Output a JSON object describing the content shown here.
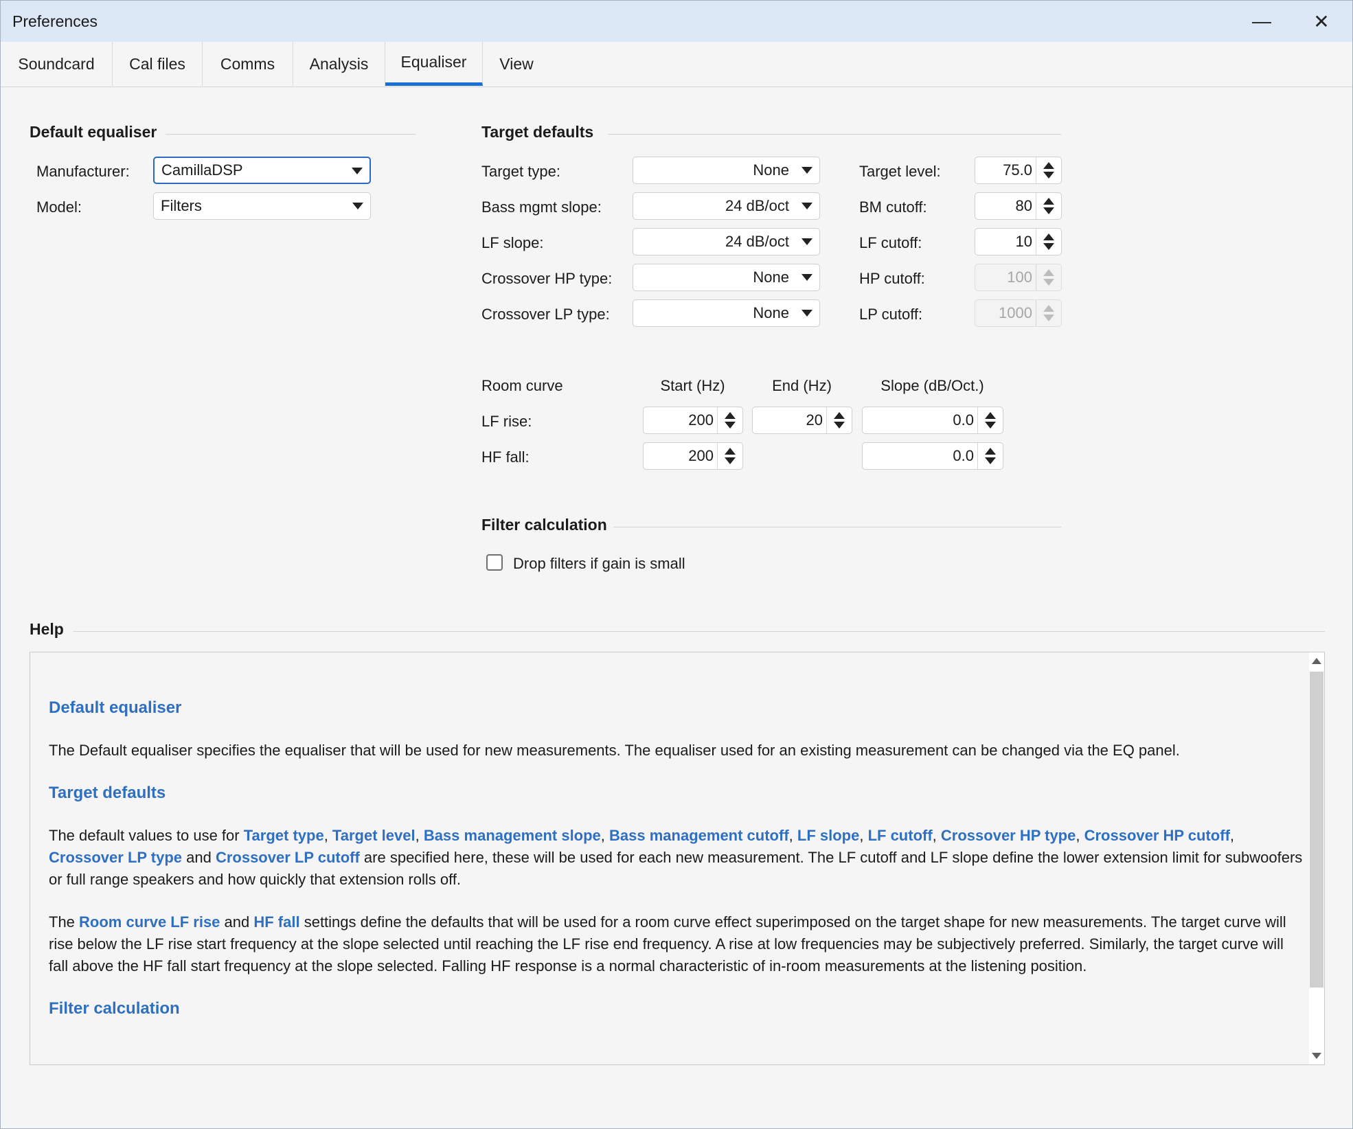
{
  "window": {
    "title": "Preferences",
    "minimize_glyph": "—",
    "close_glyph": "✕"
  },
  "tabs": [
    {
      "label": "Soundcard"
    },
    {
      "label": "Cal files"
    },
    {
      "label": "Comms"
    },
    {
      "label": "Analysis"
    },
    {
      "label": "Equaliser",
      "active": true
    },
    {
      "label": "View"
    }
  ],
  "default_equaliser": {
    "title": "Default equaliser",
    "manufacturer_label": "Manufacturer:",
    "manufacturer_value": "CamillaDSP",
    "model_label": "Model:",
    "model_value": "Filters"
  },
  "target_defaults": {
    "title": "Target defaults",
    "target_type_label": "Target type:",
    "target_type_value": "None",
    "bass_mgmt_slope_label": "Bass mgmt slope:",
    "bass_mgmt_slope_value": "24 dB/oct",
    "lf_slope_label": "LF slope:",
    "lf_slope_value": "24 dB/oct",
    "crossover_hp_type_label": "Crossover HP type:",
    "crossover_hp_type_value": "None",
    "crossover_lp_type_label": "Crossover LP type:",
    "crossover_lp_type_value": "None",
    "target_level_label": "Target level:",
    "target_level_value": "75.0",
    "bm_cutoff_label": "BM cutoff:",
    "bm_cutoff_value": "80",
    "lf_cutoff_label": "LF cutoff:",
    "lf_cutoff_value": "10",
    "hp_cutoff_label": "HP cutoff:",
    "hp_cutoff_value": "100",
    "lp_cutoff_label": "LP cutoff:",
    "lp_cutoff_value": "1000"
  },
  "room_curve": {
    "title": "Room curve",
    "start_header": "Start (Hz)",
    "end_header": "End (Hz)",
    "slope_header": "Slope (dB/Oct.)",
    "lf_rise_label": "LF rise:",
    "lf_rise_start": "200",
    "lf_rise_end": "20",
    "lf_rise_slope": "0.0",
    "hf_fall_label": "HF fall:",
    "hf_fall_start": "200",
    "hf_fall_slope": "0.0"
  },
  "filter_calculation": {
    "title": "Filter calculation",
    "drop_filters_label": "Drop filters if gain is small",
    "drop_filters_checked": false
  },
  "help": {
    "title": "Help",
    "h1": "Default equaliser",
    "p1": "The Default equaliser specifies the equaliser that will be used for new measurements. The equaliser used for an existing measurement can be changed via the EQ panel.",
    "h2": "Target defaults",
    "p2": {
      "t0": "The default values to use for ",
      "k1": "Target type",
      "t1": ", ",
      "k2": "Target level",
      "t2": ", ",
      "k3": "Bass management slope",
      "t3": ", ",
      "k4": "Bass management cutoff",
      "t4": ", ",
      "k5": "LF slope",
      "t5": ", ",
      "k6": "LF cutoff",
      "t6": ", ",
      "k7": "Crossover HP type",
      "t7": ", ",
      "k8": "Crossover HP cutoff",
      "t8": ", ",
      "k9": "Crossover LP type",
      "t9": " and ",
      "k10": "Crossover LP cutoff",
      "t10": " are specified here, these will be used for each new measurement. The LF cutoff and LF slope define the lower extension limit for subwoofers or full range speakers and how quickly that extension rolls off."
    },
    "p3": {
      "t0": "The ",
      "k1": "Room curve LF rise",
      "t1": " and ",
      "k2": "HF fall",
      "t2": " settings define the defaults that will be used for a room curve effect superimposed on the target shape for new measurements. The target curve will rise below the LF rise start frequency at the slope selected until reaching the LF rise end frequency. A rise at low frequencies may be subjectively preferred. Similarly, the target curve will fall above the HF fall start frequency at the slope selected. Falling HF response is a normal characteristic of in-room measurements at the listening position."
    },
    "h3": "Filter calculation"
  }
}
